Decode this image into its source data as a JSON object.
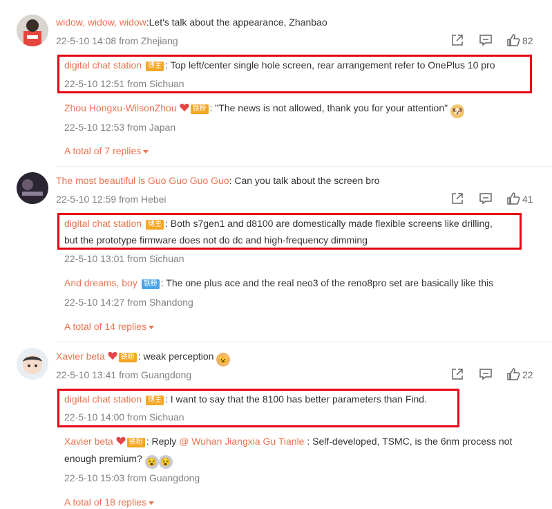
{
  "comments": [
    {
      "user": "widow, widow, widow",
      "text": ":Let's talk about the appearance, Zhanbao",
      "meta": "22-5-10 14:08 from Zhejiang",
      "likes": "82",
      "replies": [
        {
          "user": "digital chat station",
          "badge": "博主",
          "text": ": Top left/center single hole screen, rear arrangement refer to OnePlus 10 pro",
          "meta": "22-5-10 12:51 from Sichuan"
        },
        {
          "user": "Zhou Hongxu-WilsonZhou",
          "badge": "铁粉",
          "text": ": \"The news is not allowed, thank you for your attention\"",
          "meta": "22-5-10 12:53 from Japan"
        }
      ],
      "more": "A total of 7 replies"
    },
    {
      "user": "The most beautiful is Guo Guo Guo Guo",
      "text": ": Can you talk about the screen bro",
      "meta": "22-5-10 12:59 from Hebei",
      "likes": "41",
      "replies": [
        {
          "user": "digital chat station",
          "badge": "博主",
          "text": ": Both s7gen1 and d8100 are domestically made flexible screens like drilling,",
          "text2": "but the prototype firmware does not do dc and high-frequency dimming",
          "meta": "22-5-10 13:01 from Sichuan"
        },
        {
          "user": "And dreams, boy",
          "badge": "铁粉",
          "text": ": The one plus ace and the real neo3 of the reno8pro set are basically like this",
          "meta": "22-5-10 14:27 from Shandong"
        }
      ],
      "more": "A total of 14 replies"
    },
    {
      "user": "Xavier beta",
      "badge": "铁粉",
      "text": ": weak perception",
      "meta": "22-5-10 13:41 from Guangdong",
      "likes": "22",
      "replies": [
        {
          "user": "digital chat station",
          "badge": "博主",
          "text": ": I want to say that the 8100 has better parameters than Find.",
          "meta": "22-5-10 14:00 from Sichuan"
        },
        {
          "user": "Xavier beta",
          "badge": "铁粉",
          "text_prefix": ": Reply ",
          "mention": "@ Wuhan Jiangxia Gu Tianle",
          "text": " : Self-developed, TSMC, is the 6nm process not",
          "text2": "enough premium?",
          "meta": "22-5-10 15:03 from Guangdong"
        }
      ],
      "more": "A total of 18 replies"
    }
  ],
  "colors": {
    "accent": "#eb7350",
    "highlight": "#e60012",
    "meta": "#808080"
  },
  "icons": [
    "share-icon",
    "comment-icon",
    "like-icon",
    "heart-icon",
    "doge-emoji-icon",
    "face-emoji-icon"
  ]
}
